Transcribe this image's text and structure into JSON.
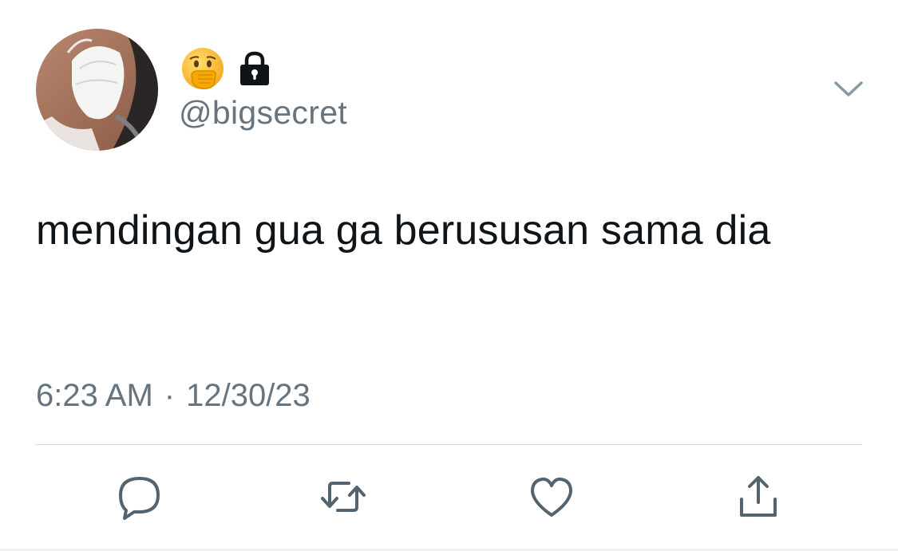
{
  "user": {
    "name_icons": [
      "face-with-hand-over-mouth-icon",
      "lock-icon"
    ],
    "handle": "@bigsecret"
  },
  "tweet": {
    "text": "mendingan gua ga berususan sama dia",
    "time": "6:23 AM",
    "separator": "·",
    "date": "12/30/23"
  },
  "actions": [
    "reply-icon",
    "retweet-icon",
    "like-icon",
    "share-icon"
  ],
  "colors": {
    "text": "#0f1419",
    "secondary": "#66747f",
    "icon": "#536471",
    "divider": "#d6dbe0"
  }
}
